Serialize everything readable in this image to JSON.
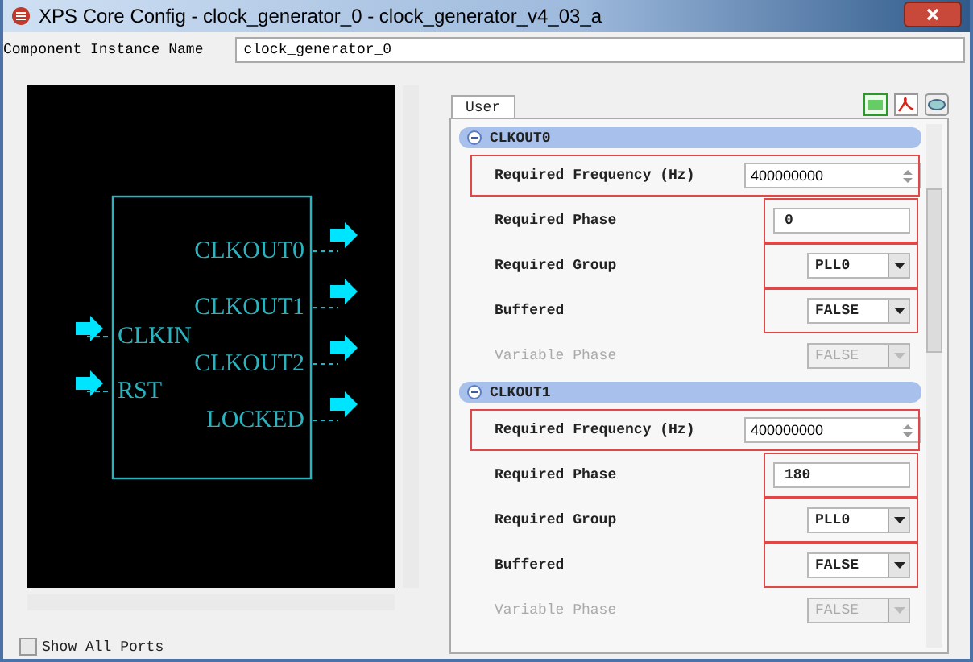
{
  "window": {
    "title": "XPS Core Config - clock_generator_0 - clock_generator_v4_03_a"
  },
  "instance": {
    "label": "Component Instance Name",
    "value": "clock_generator_0"
  },
  "symbol": {
    "inputs": [
      "CLKIN",
      "RST"
    ],
    "outputs": [
      "CLKOUT0",
      "CLKOUT1",
      "CLKOUT2",
      "LOCKED"
    ]
  },
  "show_all_ports": {
    "label": "Show All Ports",
    "checked": false
  },
  "tabs": [
    {
      "label": "User",
      "selected": true
    }
  ],
  "sections": [
    {
      "title": "CLKOUT0",
      "expanded": true,
      "fields": [
        {
          "kind": "spin",
          "label": "Required Frequency (Hz)",
          "value": "400000000",
          "highlighted": true,
          "disabled": false
        },
        {
          "kind": "text",
          "label": "Required Phase",
          "value": "0",
          "highlighted": true,
          "disabled": false
        },
        {
          "kind": "select",
          "label": "Required Group",
          "value": "PLL0",
          "highlighted": true,
          "disabled": false
        },
        {
          "kind": "select",
          "label": "Buffered",
          "value": "FALSE",
          "highlighted": true,
          "disabled": false
        },
        {
          "kind": "select",
          "label": "Variable Phase",
          "value": "FALSE",
          "highlighted": false,
          "disabled": true
        }
      ]
    },
    {
      "title": "CLKOUT1",
      "expanded": true,
      "fields": [
        {
          "kind": "spin",
          "label": "Required Frequency (Hz)",
          "value": "400000000",
          "highlighted": true,
          "disabled": false
        },
        {
          "kind": "text",
          "label": "Required Phase",
          "value": "180",
          "highlighted": true,
          "disabled": false
        },
        {
          "kind": "select",
          "label": "Required Group",
          "value": "PLL0",
          "highlighted": true,
          "disabled": false
        },
        {
          "kind": "select",
          "label": "Buffered",
          "value": "FALSE",
          "highlighted": true,
          "disabled": false
        },
        {
          "kind": "select",
          "label": "Variable Phase",
          "value": "FALSE",
          "highlighted": false,
          "disabled": true
        }
      ]
    }
  ]
}
